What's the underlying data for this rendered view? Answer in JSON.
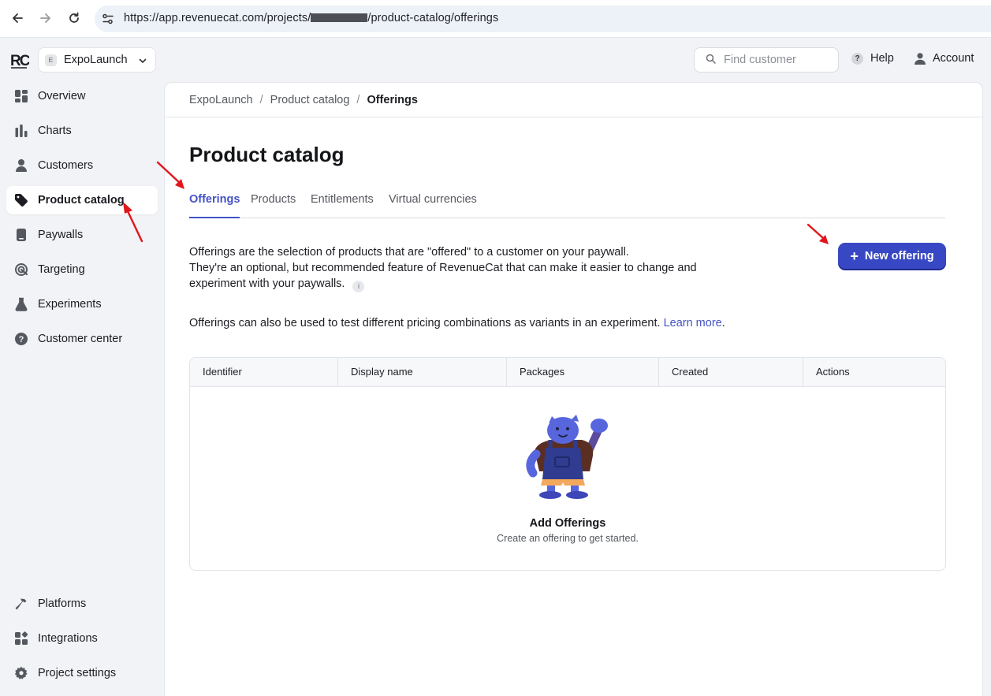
{
  "browser": {
    "url_prefix": "https://app.revenuecat.com/projects/",
    "url_suffix": "/product-catalog/offerings"
  },
  "topbar": {
    "project_badge": "E",
    "project_name": "ExpoLaunch",
    "search_placeholder": "Find customer",
    "help_label": "Help",
    "account_label": "Account"
  },
  "sidebar": {
    "items": [
      {
        "label": "Overview",
        "icon": "overview-icon"
      },
      {
        "label": "Charts",
        "icon": "charts-icon"
      },
      {
        "label": "Customers",
        "icon": "customers-icon"
      },
      {
        "label": "Product catalog",
        "icon": "tag-icon",
        "active": true
      },
      {
        "label": "Paywalls",
        "icon": "paywalls-icon"
      },
      {
        "label": "Targeting",
        "icon": "targeting-icon"
      },
      {
        "label": "Experiments",
        "icon": "flask-icon"
      },
      {
        "label": "Customer center",
        "icon": "help-circle-icon"
      }
    ],
    "bottom_items": [
      {
        "label": "Platforms",
        "icon": "hammer-icon"
      },
      {
        "label": "Integrations",
        "icon": "integrations-icon"
      },
      {
        "label": "Project settings",
        "icon": "gear-icon"
      }
    ]
  },
  "breadcrumb": {
    "items": [
      "ExpoLaunch",
      "Product catalog",
      "Offerings"
    ],
    "separator": "/"
  },
  "page": {
    "title": "Product catalog",
    "tabs": [
      "Offerings",
      "Products",
      "Entitlements",
      "Virtual currencies"
    ],
    "active_tab": "Offerings",
    "description_line1": "Offerings are the selection of products that are \"offered\" to a customer on your paywall.",
    "description_line2": "They're an optional, but recommended feature of RevenueCat that can make it easier to change and experiment with your paywalls.",
    "description2": "Offerings can also be used to test different pricing combinations as variants in an experiment.",
    "learn_more": "Learn more",
    "learn_more_period": ".",
    "new_offering_label": "New offering"
  },
  "table": {
    "columns": [
      "Identifier",
      "Display name",
      "Packages",
      "Created",
      "Actions"
    ],
    "empty_title": "Add Offerings",
    "empty_subtitle": "Create an offering to get started."
  },
  "colors": {
    "accent": "#4452c7",
    "button": "#3847c3",
    "annotation_arrow": "#e0161b"
  }
}
